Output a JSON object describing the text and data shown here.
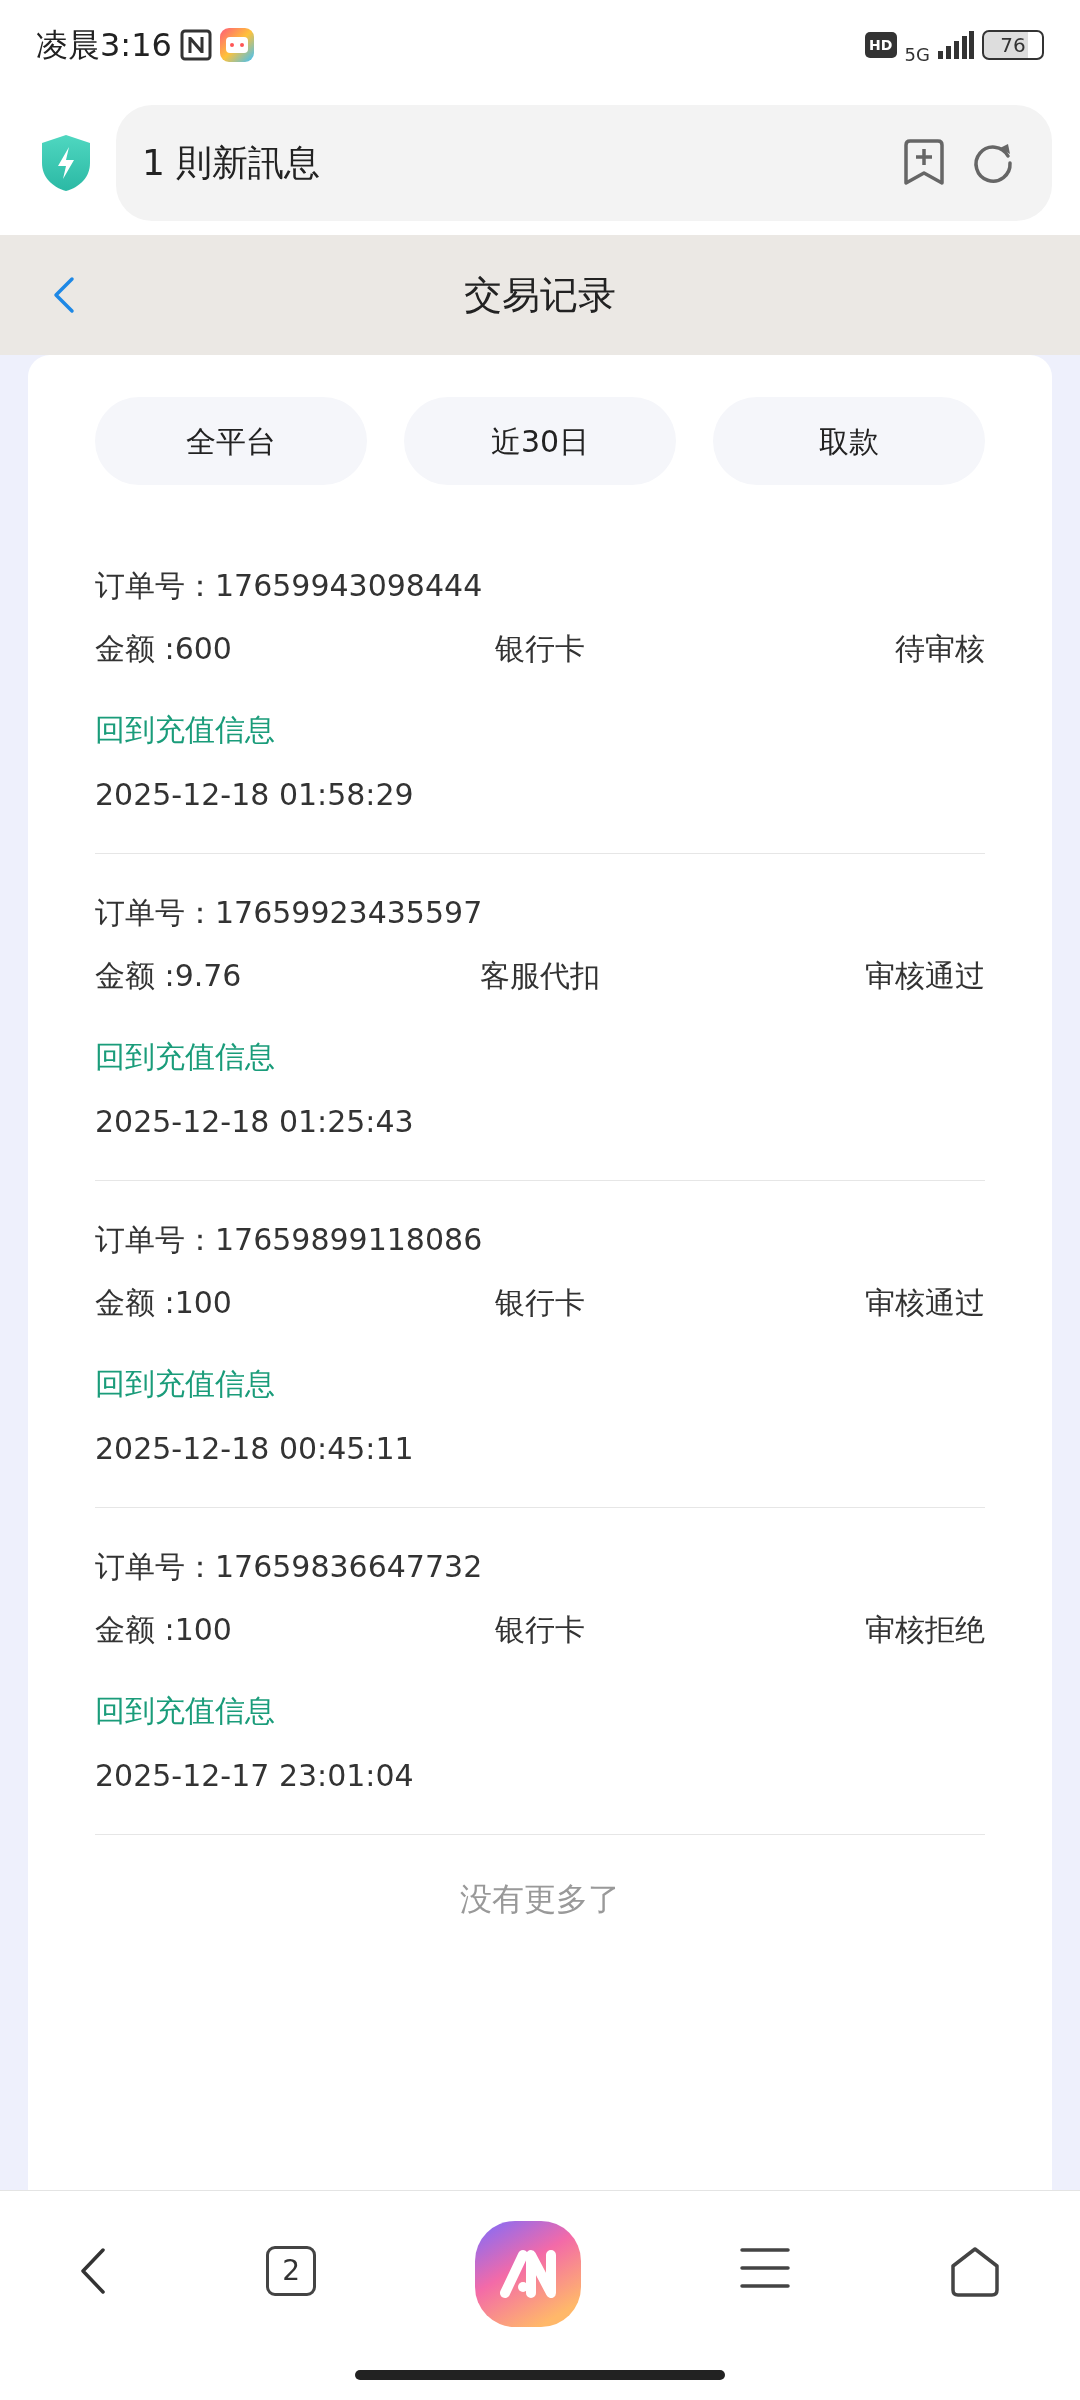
{
  "status_bar": {
    "time": "凌晨3:16",
    "hd": "HD",
    "network": "5G",
    "battery": "76"
  },
  "browser": {
    "address": "1 則新訊息"
  },
  "header": {
    "title": "交易记录"
  },
  "filters": [
    {
      "label": "全平台"
    },
    {
      "label": "近30日"
    },
    {
      "label": "取款"
    }
  ],
  "records": [
    {
      "order": "订单号：17659943098444",
      "amount": "金额 :600",
      "method": "银行卡",
      "status": "待审核",
      "link": "回到充值信息",
      "time": "2025-12-18 01:58:29"
    },
    {
      "order": "订单号：17659923435597",
      "amount": "金额 :9.76",
      "method": "客服代扣",
      "status": "审核通过",
      "link": "回到充值信息",
      "time": "2025-12-18 01:25:43"
    },
    {
      "order": "订单号：17659899118086",
      "amount": "金额 :100",
      "method": "银行卡",
      "status": "审核通过",
      "link": "回到充值信息",
      "time": "2025-12-18 00:45:11"
    },
    {
      "order": "订单号：17659836647732",
      "amount": "金额 :100",
      "method": "银行卡",
      "status": "审核拒绝",
      "link": "回到充值信息",
      "time": "2025-12-17 23:01:04"
    }
  ],
  "end_note": "没有更多了",
  "bottom_bar": {
    "tabs_count": "2"
  }
}
